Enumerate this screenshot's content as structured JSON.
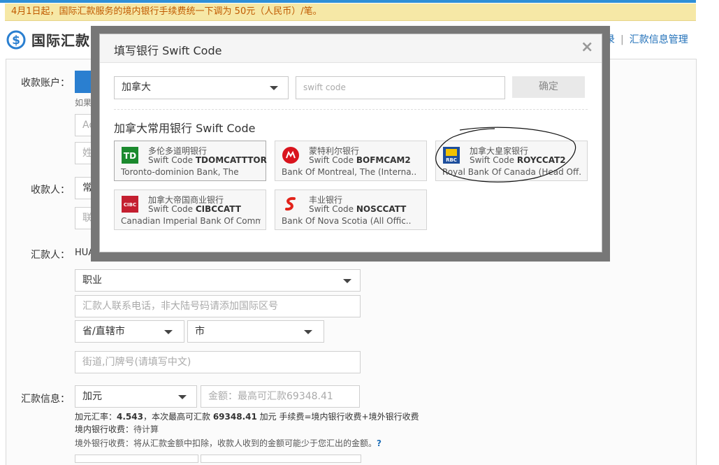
{
  "notice": "4月1日起，国际汇款服务的境内银行手续费统一下调为 50元（人民币）/笔。",
  "page_title": "国际汇款",
  "top_links": [
    "录",
    "汇款信息管理"
  ],
  "form": {
    "receiver_account_label": "收款账户：",
    "receiver_hint": "如果",
    "receiver_field1_partial": "Acc",
    "receiver_field2_partial": "姓",
    "payee_label": "收款人：",
    "payee_field1_partial": "常",
    "payee_field2_partial": "联",
    "remitter_label": "汇款人：",
    "remitter_value_partial": "HUAI",
    "occupation": "职业",
    "phone_placeholder": "汇款人联系电话，非大陆号码请添加国际区号",
    "province": "省/直辖市",
    "city": "市",
    "street_placeholder": "街道,门牌号(请填写中文)",
    "info_label": "汇款信息：",
    "currency": "加元",
    "amount_placeholder": "金额：最高可汇款69348.41",
    "rate_line_prefix": "加元汇率：",
    "rate_value": "4.543",
    "rate_line_mid": "，本次最高可汇款",
    "max_value": "69348.41",
    "rate_line_suffix": "加元 手续费=境内银行收费+境外银行收费",
    "domestic_fee_label": "境内银行收费：",
    "domestic_fee_value": "待计算",
    "foreign_fee_label": "境外银行收费：",
    "foreign_fee_text": "将从汇款金额中扣除，收款人收到的金额可能少于您汇出的金额。",
    "help_icon": "?"
  },
  "dialog": {
    "title": "填写银行 Swift Code",
    "close": "×",
    "country": "加拿大",
    "swift_placeholder": "swift code",
    "confirm": "确定",
    "subtitle": "加拿大常用银行 Swift Code",
    "swift_prefix": "Swift Code ",
    "banks": [
      {
        "cn": "多伦多道明银行",
        "code": "TDOMCATTTOR",
        "en": "Toronto-dominion Bank, The",
        "icon": "td-bank-icon",
        "color": "#1b8a2e"
      },
      {
        "cn": "蒙特利尔银行",
        "code": "BOFMCAM2",
        "en": "Bank Of Montreal, The (Interna..",
        "icon": "bmo-bank-icon",
        "color": "#d9141d"
      },
      {
        "cn": "加拿大皇家银行",
        "code": "ROYCCAT2",
        "en": "Royal Bank Of Canada (Head Off..",
        "icon": "rbc-bank-icon",
        "color": "#1d4e9c"
      },
      {
        "cn": "加拿大帝国商业银行",
        "code": "CIBCCATT",
        "en": "Canadian Imperial Bank Of Comm..",
        "icon": "cibc-bank-icon",
        "color": "#c41f30"
      },
      {
        "cn": "丰业银行",
        "code": "NOSCCATT",
        "en": "Bank Of Nova Scotia (All Offic..",
        "icon": "scotiabank-icon",
        "color": "#e2231a"
      }
    ]
  },
  "colors": {
    "notice_bg": "#f6e8a6",
    "notice_text": "#c05a00",
    "link": "#1f6fb8",
    "overlay_frame": "#777777"
  }
}
